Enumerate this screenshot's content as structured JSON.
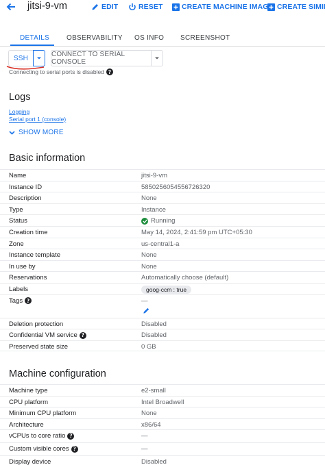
{
  "header": {
    "title": "jitsi-9-vm",
    "edit_label": "EDIT",
    "reset_label": "RESET",
    "create_image_label": "CREATE MACHINE IMAGE",
    "create_similar_label": "CREATE SIMILAR"
  },
  "tabs": [
    {
      "label": "DETAILS",
      "active": true
    },
    {
      "label": "OBSERVABILITY",
      "active": false
    },
    {
      "label": "OS INFO",
      "active": false
    },
    {
      "label": "SCREENSHOT",
      "active": false
    }
  ],
  "actions": {
    "ssh_label": "SSH",
    "serial_console_label": "CONNECT TO SERIAL CONSOLE",
    "serial_note": "Connecting to serial ports is disabled"
  },
  "logs": {
    "title": "Logs",
    "links": [
      "Logging",
      "Serial port 1 (console)"
    ],
    "show_more": "SHOW MORE"
  },
  "basic_info": {
    "title": "Basic information",
    "rows": [
      {
        "key": "Name",
        "value": "jitsi-9-vm"
      },
      {
        "key": "Instance ID",
        "value": "5850256054556726320"
      },
      {
        "key": "Description",
        "value": "None"
      },
      {
        "key": "Type",
        "value": "Instance"
      },
      {
        "key": "Status",
        "value": "Running"
      },
      {
        "key": "Creation time",
        "value": "May 14, 2024, 2:41:59 pm UTC+05:30"
      },
      {
        "key": "Zone",
        "value": "us-central1-a"
      },
      {
        "key": "Instance template",
        "value": "None"
      },
      {
        "key": "In use by",
        "value": "None"
      },
      {
        "key": "Reservations",
        "value": "Automatically choose (default)"
      },
      {
        "key": "Labels",
        "value": "goog-ccm : true"
      },
      {
        "key": "Tags",
        "value": "—"
      },
      {
        "key": "Deletion protection",
        "value": "Disabled"
      },
      {
        "key": "Confidential VM service",
        "value": "Disabled"
      },
      {
        "key": "Preserved state size",
        "value": "0 GB"
      }
    ]
  },
  "machine_config": {
    "title": "Machine configuration",
    "rows": [
      {
        "key": "Machine type",
        "value": "e2-small"
      },
      {
        "key": "CPU platform",
        "value": "Intel Broadwell"
      },
      {
        "key": "Minimum CPU platform",
        "value": "None"
      },
      {
        "key": "Architecture",
        "value": "x86/64"
      },
      {
        "key": "vCPUs to core ratio",
        "value": "—"
      },
      {
        "key": "Custom visible cores",
        "value": "—"
      },
      {
        "key": "Display device",
        "value": "Disabled"
      }
    ]
  },
  "colors": {
    "accent": "#1a73e8",
    "running": "#1e8e3e",
    "annotation": "#d93025"
  },
  "icons": {
    "back": "arrow-left-icon",
    "edit": "pencil-icon",
    "reset": "power-icon",
    "create_image": "plus-box-icon",
    "create_similar": "plus-box-icon",
    "status": "check-circle-icon",
    "help": "question-circle-icon"
  }
}
